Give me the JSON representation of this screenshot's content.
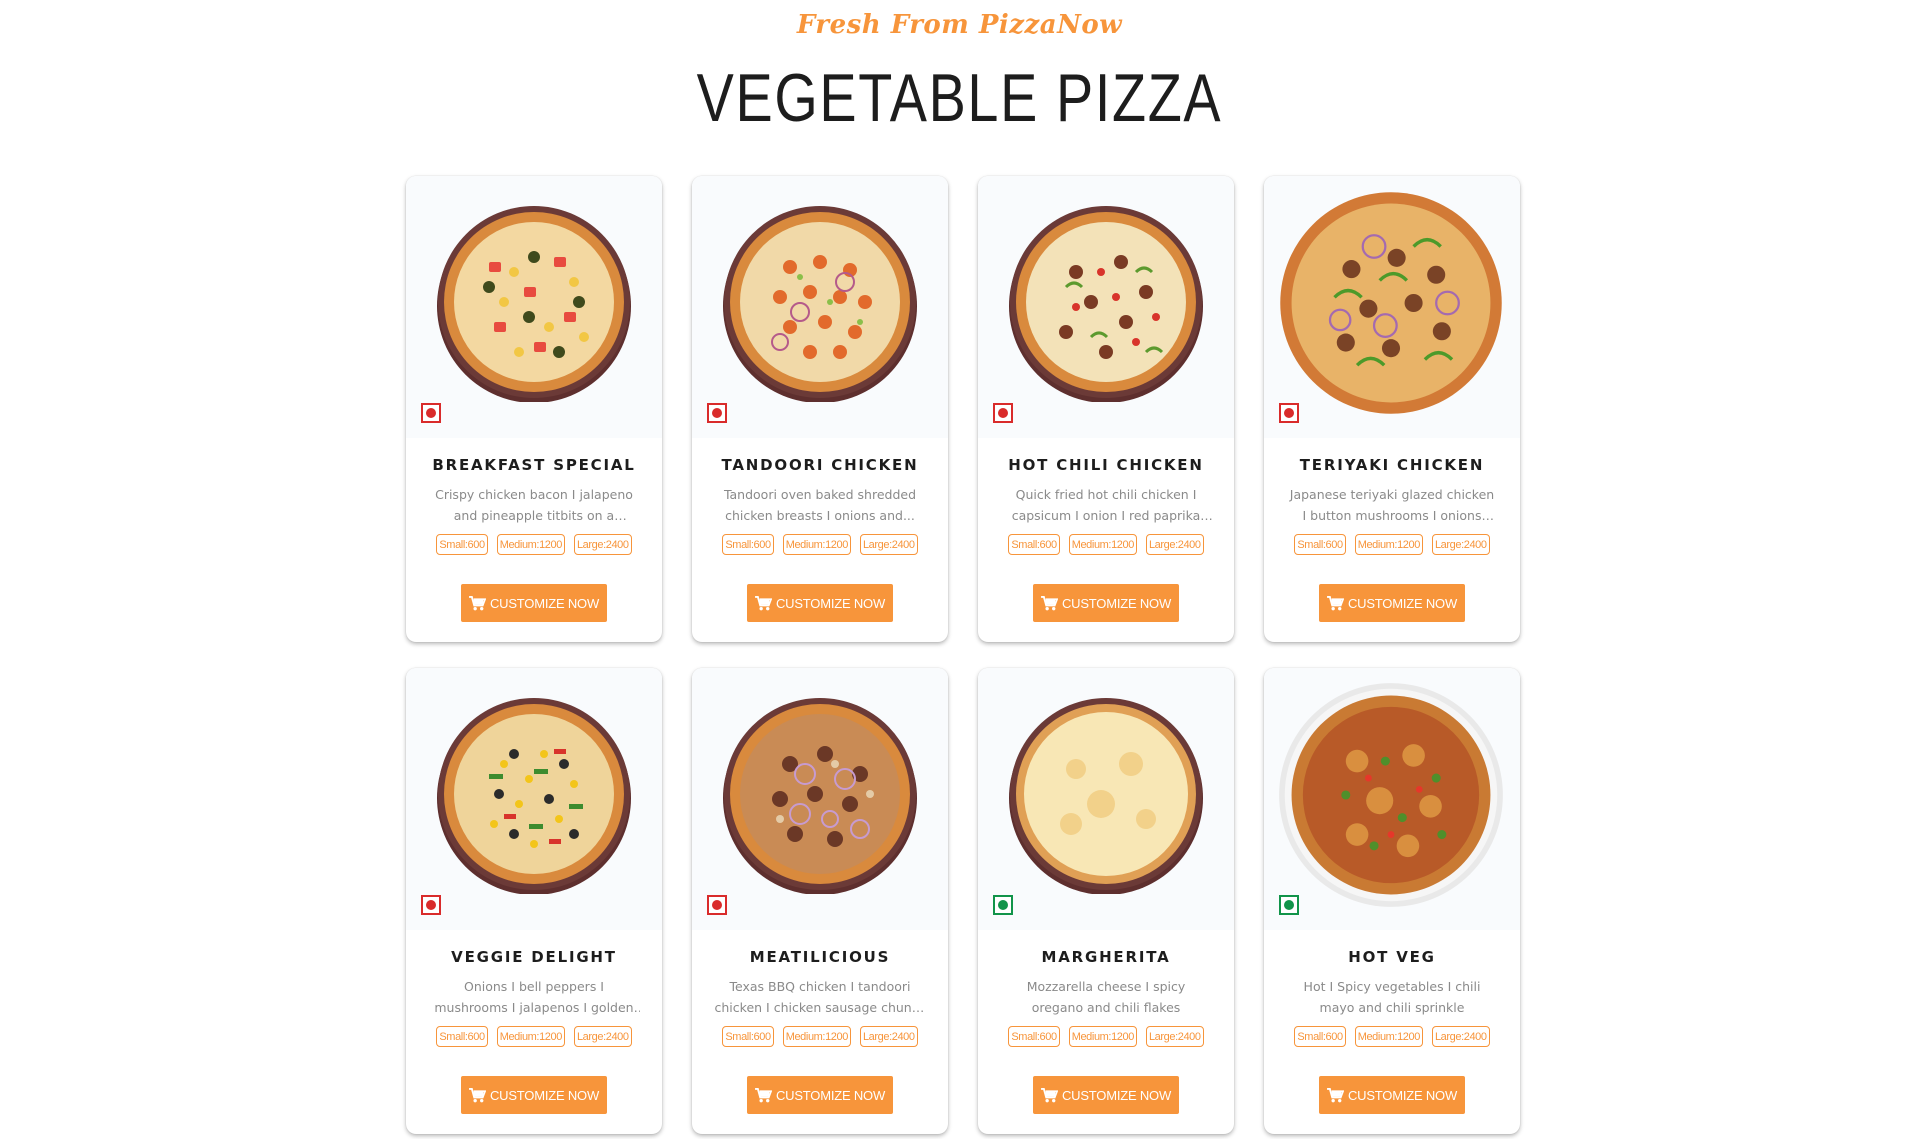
{
  "header": {
    "tagline": "Fresh From PizzaNow",
    "title": "VEGETABLE PIZZA"
  },
  "colors": {
    "accent": "#f7953b",
    "nonveg": "#d92b2b",
    "veg": "#12944a"
  },
  "button_label": "CUSTOMIZE NOW",
  "button_icon": "cart-icon",
  "products": [
    {
      "name": "BREAKFAST SPECIAL",
      "desc": "Crispy chicken bacon I jalapeno and pineapple titbits on a mozzarella...",
      "diet": "nonveg",
      "sizes": [
        "Small:600",
        "Medium:1200",
        "Large:2400"
      ]
    },
    {
      "name": "TANDOORI CHICKEN",
      "desc": "Tandoori oven baked shredded chicken breasts I onions and...",
      "diet": "nonveg",
      "sizes": [
        "Small:600",
        "Medium:1200",
        "Large:2400"
      ]
    },
    {
      "name": "HOT CHILI CHICKEN",
      "desc": "Quick fried hot chili chicken I capsicum I onion I red paprika slic...",
      "diet": "nonveg",
      "sizes": [
        "Small:600",
        "Medium:1200",
        "Large:2400"
      ]
    },
    {
      "name": "TERIYAKI CHICKEN",
      "desc": "Japanese teriyaki glazed chicken I button mushrooms I onions and...",
      "diet": "nonveg",
      "sizes": [
        "Small:600",
        "Medium:1200",
        "Large:2400"
      ]
    },
    {
      "name": "VEGGIE DELIGHT",
      "desc": "Onions I bell peppers I mushrooms I jalapenos I golden corn and olives-...",
      "diet": "nonveg",
      "sizes": [
        "Small:600",
        "Medium:1200",
        "Large:2400"
      ]
    },
    {
      "name": "MEATILICIOUS",
      "desc": "Texas BBQ chicken I tandoori chicken I chicken sausage chunks I...",
      "diet": "nonveg",
      "sizes": [
        "Small:600",
        "Medium:1200",
        "Large:2400"
      ]
    },
    {
      "name": "MARGHERITA",
      "desc": "Mozzarella cheese I spicy oregano and chili flakes",
      "diet": "veg",
      "sizes": [
        "Small:600",
        "Medium:1200",
        "Large:2400"
      ]
    },
    {
      "name": "HOT VEG",
      "desc": "Hot I Spicy vegetables I chili mayo and chili sprinkle",
      "diet": "veg",
      "sizes": [
        "Small:600",
        "Medium:1200",
        "Large:2400"
      ]
    }
  ]
}
